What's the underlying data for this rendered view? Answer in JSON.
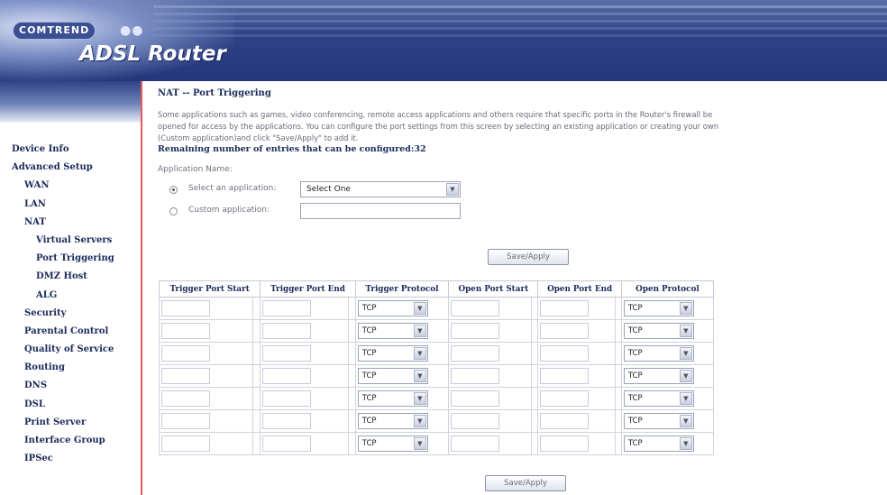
{
  "banner": {
    "brand": "COMTREND",
    "product": "ADSL Router"
  },
  "sidebar": {
    "items": [
      {
        "label": "Device Info",
        "level": 0
      },
      {
        "label": "Advanced Setup",
        "level": 0
      },
      {
        "label": "WAN",
        "level": 1
      },
      {
        "label": "LAN",
        "level": 1
      },
      {
        "label": "NAT",
        "level": 1
      },
      {
        "label": "Virtual Servers",
        "level": 2
      },
      {
        "label": "Port Triggering",
        "level": 2
      },
      {
        "label": "DMZ Host",
        "level": 2
      },
      {
        "label": "ALG",
        "level": 2
      },
      {
        "label": "Security",
        "level": 1
      },
      {
        "label": "Parental Control",
        "level": 1
      },
      {
        "label": "Quality of Service",
        "level": 1
      },
      {
        "label": "Routing",
        "level": 1
      },
      {
        "label": "DNS",
        "level": 1
      },
      {
        "label": "DSL",
        "level": 1
      },
      {
        "label": "Print Server",
        "level": 1
      },
      {
        "label": "Interface Group",
        "level": 1
      },
      {
        "label": "IPSec",
        "level": 1
      }
    ]
  },
  "main": {
    "title": "NAT -- Port Triggering",
    "description_lines": [
      "Some applications such as games, video conferencing, remote access applications and others require that specific ports in the Router's firewall be",
      "opened for access by the applications. You can configure the port settings from this screen by selecting an existing application or creating your own",
      "(Custom application)and click \"Save/Apply\" to add it."
    ],
    "remaining": "Remaining number of entries that can be configured:32",
    "app_name_label": "Application Name:",
    "select_app_label": "Select an application:",
    "select_app_value": "Select One",
    "custom_app_label": "Custom application:",
    "custom_app_value": "",
    "save_apply": "Save/Apply"
  },
  "table": {
    "headers": [
      "Trigger Port Start",
      "Trigger Port End",
      "Trigger Protocol",
      "Open Port Start",
      "Open Port End",
      "Open Protocol"
    ],
    "rows": [
      {
        "trigger_start": "",
        "trigger_end": "",
        "trigger_protocol": "TCP",
        "open_start": "",
        "open_end": "",
        "open_protocol": "TCP"
      },
      {
        "trigger_start": "",
        "trigger_end": "",
        "trigger_protocol": "TCP",
        "open_start": "",
        "open_end": "",
        "open_protocol": "TCP"
      },
      {
        "trigger_start": "",
        "trigger_end": "",
        "trigger_protocol": "TCP",
        "open_start": "",
        "open_end": "",
        "open_protocol": "TCP"
      },
      {
        "trigger_start": "",
        "trigger_end": "",
        "trigger_protocol": "TCP",
        "open_start": "",
        "open_end": "",
        "open_protocol": "TCP"
      },
      {
        "trigger_start": "",
        "trigger_end": "",
        "trigger_protocol": "TCP",
        "open_start": "",
        "open_end": "",
        "open_protocol": "TCP"
      },
      {
        "trigger_start": "",
        "trigger_end": "",
        "trigger_protocol": "TCP",
        "open_start": "",
        "open_end": "",
        "open_protocol": "TCP"
      },
      {
        "trigger_start": "",
        "trigger_end": "",
        "trigger_protocol": "TCP",
        "open_start": "",
        "open_end": "",
        "open_protocol": "TCP"
      }
    ]
  },
  "colors": {
    "banner": "#2f4487",
    "menu_text": "#1a2a5a",
    "sidebar_border": "#e55a5a"
  }
}
